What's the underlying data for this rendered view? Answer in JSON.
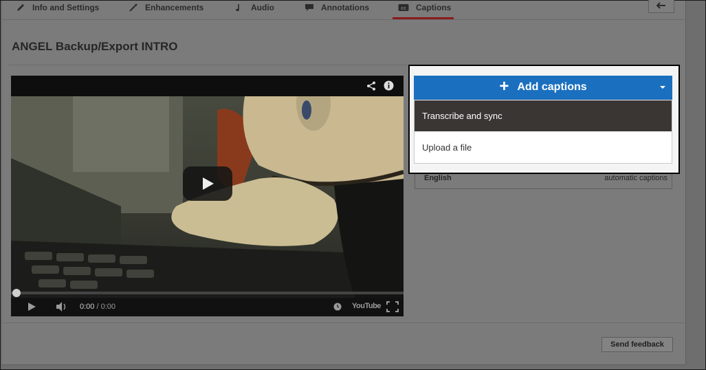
{
  "tabs": [
    {
      "label": "Info and Settings",
      "icon": "pencil-icon"
    },
    {
      "label": "Enhancements",
      "icon": "wand-icon"
    },
    {
      "label": "Audio",
      "icon": "music-note-icon"
    },
    {
      "label": "Annotations",
      "icon": "speech-bubble-icon"
    },
    {
      "label": "Captions",
      "icon": "cc-icon"
    }
  ],
  "active_tab": "Captions",
  "video": {
    "title": "ANGEL Backup/Export INTRO",
    "time_current": "0:00",
    "time_separator": "/",
    "time_total": "0:00",
    "progress": 0,
    "youtube_logo": "YouTube"
  },
  "captions_menu": {
    "add_button_label": "Add captions",
    "items": [
      "Transcribe and sync",
      "Upload a file"
    ],
    "highlighted_item": "Transcribe and sync"
  },
  "caption_track": {
    "language": "English",
    "type": "automatic captions"
  },
  "footer": {
    "send_feedback_label": "Send feedback"
  },
  "colors": {
    "accent_blue": "#1b6fbf",
    "menu_highlight": "#3a3634",
    "active_tab_underline": "#8a1a1a"
  }
}
